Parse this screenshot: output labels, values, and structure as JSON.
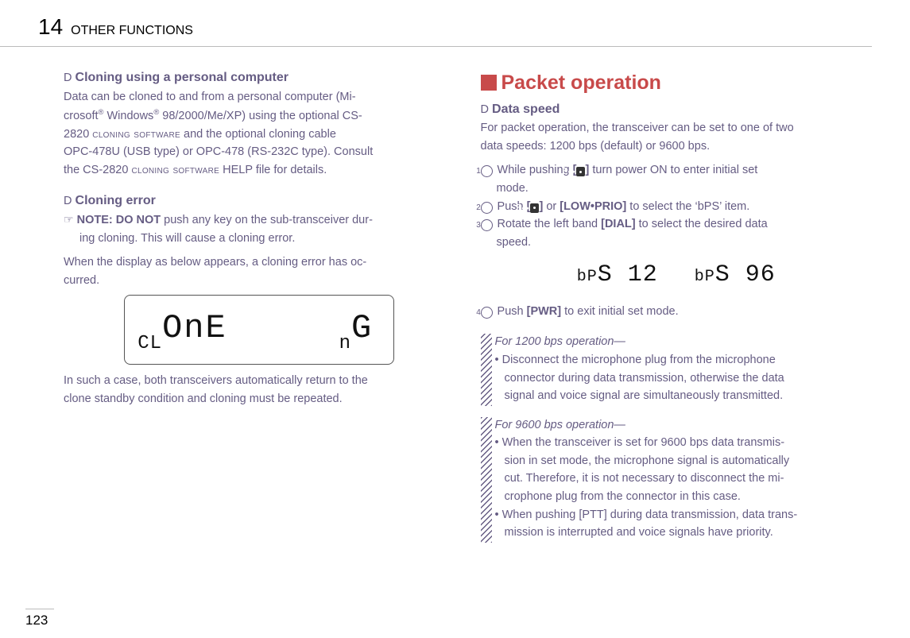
{
  "header": {
    "chapter_number": "14",
    "chapter_title": "OTHER FUNCTIONS"
  },
  "left": {
    "h1_prefix": "D",
    "h1": "Cloning using a personal computer",
    "p1a": "Data can be cloned to and from a personal computer (Mi-",
    "p1b": "crosoft",
    "p1c": " Windows",
    "p1d": " 98/2000/Me/XP) using the optional CS-",
    "p1e": "2820 ",
    "p1e_sc": "cloning software",
    "p1f": " and the optional cloning cable",
    "p1g": "OPC-478U (USB type) or OPC-478 (RS-232C type). Consult",
    "p1h": "the CS-2820 ",
    "p1h_sc": "cloning software",
    "p1i": " HELP file for details.",
    "h2_prefix": "D",
    "h2": "Cloning error",
    "note_prefix": "☞",
    "note_bold": "NOTE: DO NOT",
    "note_rest": " push any key on the sub-transceiver dur-",
    "note_rest2": "ing cloning. This will cause a cloning error.",
    "p2a": "When the display as below appears, a cloning error has oc-",
    "p2b": "curred.",
    "lcd_left_small": "CL",
    "lcd_left_big": "OnE",
    "lcd_right_small": "n",
    "lcd_right_big": "G",
    "p3a": "In such a case, both transceivers automatically return to the",
    "p3b": "clone standby condition and cloning must be repeated."
  },
  "right": {
    "section_title": "Packet operation",
    "h1_prefix": "D",
    "h1": "Data speed",
    "p1a": "For packet operation, the transceiver can be set to one of two",
    "p1b": "data speeds: 1200 bps (default) or 9600 bps.",
    "li1a": " While pushing ",
    "li1b": " turn power ON to enter initial set",
    "li1c": "mode.",
    "li2a": " Push ",
    "li2b": " or ",
    "li2c": "[LOW•PRIO]",
    "li2d": " to select the ‘bPS’ item.",
    "li3a": " Rotate the left band ",
    "li3b": "[DIAL]",
    "li3c": " to select the desired data",
    "li3d": "speed.",
    "lcd1_pre": "bP",
    "lcd1_big": "S 12",
    "lcd2_pre": "bP",
    "lcd2_big": "S 96",
    "li4a": " Push ",
    "li4b": "[PWR]",
    "li4c": " to exit initial set mode.",
    "note1_title": "For 1200 bps operation—",
    "note1_b1a": "Disconnect the microphone plug from the microphone",
    "note1_b1b": "connector during data transmission, otherwise the data",
    "note1_b1c": "signal and voice signal are simultaneously transmitted.",
    "note2_title": "For 9600 bps operation—",
    "note2_b1a": "When the transceiver is set for 9600 bps data transmis-",
    "note2_b1b": "sion in set mode, the microphone signal is automatically",
    "note2_b1c": "cut. Therefore, it is not necessary to disconnect the mi-",
    "note2_b1d": "crophone plug from the connector in this case.",
    "note2_b2a": "When pushing [PTT] during data transmission, data trans-",
    "note2_b2b": "mission is interrupted and voice signals have priority."
  },
  "key_labels": {
    "F": "F",
    "bracket_open": "[",
    "bracket_close": "]"
  },
  "page_number": "123",
  "list_nums": {
    "n1": "1",
    "n2": "2",
    "n3": "3",
    "n4": "4"
  }
}
